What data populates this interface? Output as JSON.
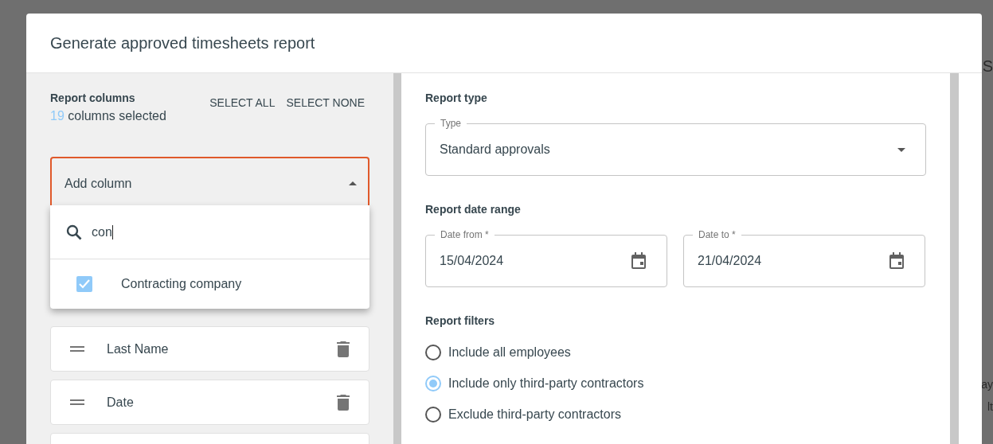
{
  "background": {
    "fragments": [
      "S",
      "ay",
      "lt"
    ]
  },
  "dialog": {
    "title": "Generate approved timesheets report"
  },
  "columns_panel": {
    "heading": "Report columns",
    "count": "19",
    "count_suffix": "columns selected",
    "actions": [
      "SELECT ALL",
      "SELECT NONE"
    ],
    "add_select": {
      "placeholder": "Add column",
      "expanded": true
    },
    "dropdown": {
      "search": "con",
      "options": [
        {
          "label": "Contracting company",
          "checked": true
        }
      ]
    },
    "items": [
      {
        "label": "Last Name"
      },
      {
        "label": "Date"
      }
    ]
  },
  "report_type": {
    "heading": "Report type",
    "field": {
      "label": "Type",
      "value": "Standard approvals"
    }
  },
  "date_range": {
    "heading": "Report date range",
    "fields": [
      {
        "label": "Date from *",
        "value": "15/04/2024"
      },
      {
        "label": "Date to *",
        "value": "21/04/2024"
      }
    ]
  },
  "filters": {
    "heading": "Report filters",
    "options": [
      {
        "label": "Include all employees",
        "selected": false
      },
      {
        "label": "Include only third-party contractors",
        "selected": true
      },
      {
        "label": "Exclude third-party contractors",
        "selected": false
      }
    ]
  }
}
